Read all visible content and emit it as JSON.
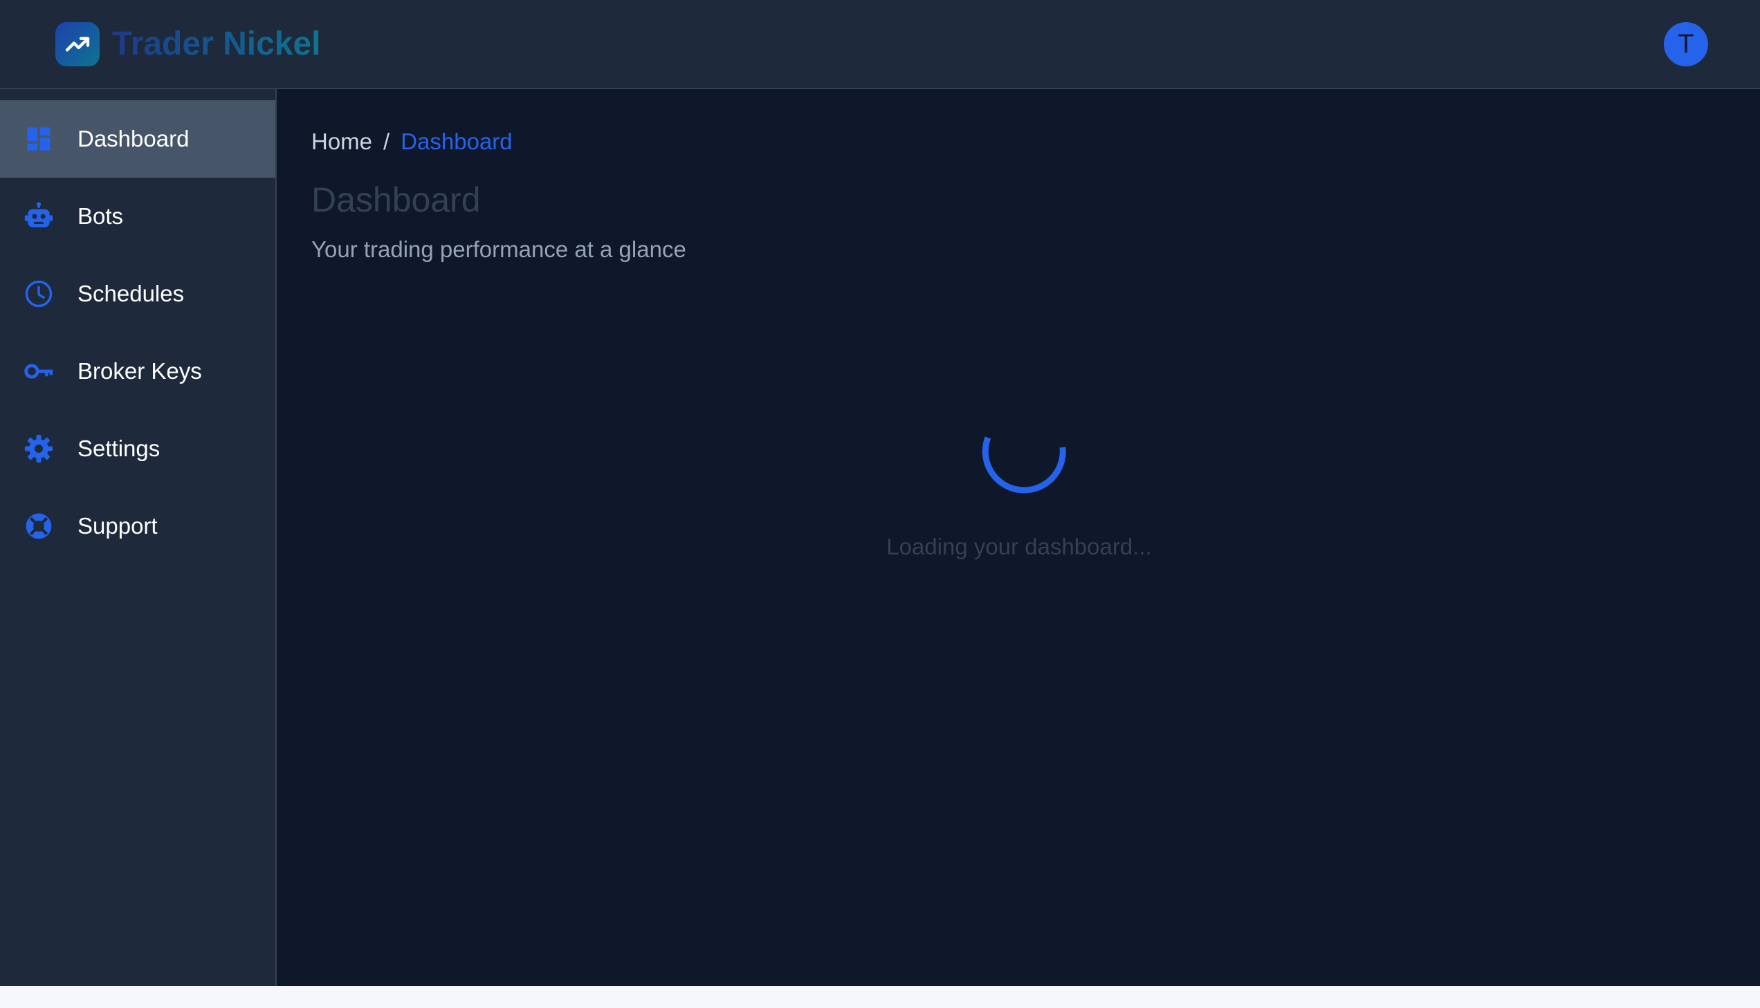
{
  "app": {
    "name": "Trader Nickel",
    "logo_icon": "trending-up-icon"
  },
  "user": {
    "avatar_initial": "T"
  },
  "sidebar": {
    "items": [
      {
        "label": "Dashboard",
        "icon": "dashboard-icon",
        "active": true
      },
      {
        "label": "Bots",
        "icon": "robot-icon",
        "active": false
      },
      {
        "label": "Schedules",
        "icon": "clock-icon",
        "active": false
      },
      {
        "label": "Broker Keys",
        "icon": "key-icon",
        "active": false
      },
      {
        "label": "Settings",
        "icon": "gear-icon",
        "active": false
      },
      {
        "label": "Support",
        "icon": "lifebuoy-icon",
        "active": false
      }
    ]
  },
  "breadcrumb": {
    "home": "Home",
    "separator": "/",
    "current": "Dashboard"
  },
  "page": {
    "title": "Dashboard",
    "subtitle": "Your trading performance at a glance",
    "loading_text": "Loading your dashboard..."
  },
  "colors": {
    "accent": "#2563eb",
    "sidebar_bg": "#1e293b",
    "main_bg": "#0f172a",
    "active_item_bg": "#475569"
  }
}
